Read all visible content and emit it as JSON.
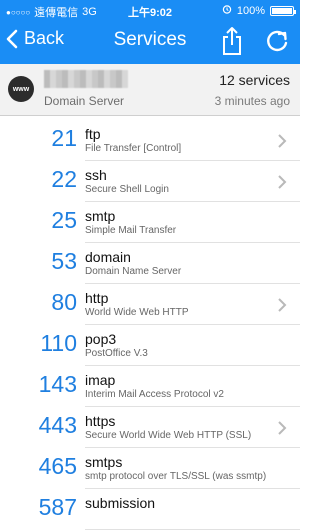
{
  "status_bar": {
    "carrier": "遠傳電信",
    "network": "3G",
    "time": "上午9:02",
    "battery": "100%"
  },
  "nav": {
    "back_label": "Back",
    "title": "Services"
  },
  "server": {
    "hostname_obscured": true,
    "icon_text": "www",
    "type_label": "Domain Server",
    "services_count": "12 services",
    "updated": "3 minutes ago"
  },
  "services": [
    {
      "port": "21",
      "name": "ftp",
      "desc": "File Transfer [Control]",
      "has_chevron": true
    },
    {
      "port": "22",
      "name": "ssh",
      "desc": "Secure Shell Login",
      "has_chevron": true
    },
    {
      "port": "25",
      "name": "smtp",
      "desc": "Simple Mail Transfer",
      "has_chevron": false
    },
    {
      "port": "53",
      "name": "domain",
      "desc": "Domain Name Server",
      "has_chevron": false
    },
    {
      "port": "80",
      "name": "http",
      "desc": "World Wide Web HTTP",
      "has_chevron": true
    },
    {
      "port": "110",
      "name": "pop3",
      "desc": "PostOffice V.3",
      "has_chevron": false
    },
    {
      "port": "143",
      "name": "imap",
      "desc": "Interim Mail Access Protocol v2",
      "has_chevron": false
    },
    {
      "port": "443",
      "name": "https",
      "desc": "Secure World Wide Web HTTP (SSL)",
      "has_chevron": true
    },
    {
      "port": "465",
      "name": "smtps",
      "desc": "smtp protocol over TLS/SSL (was ssmtp)",
      "has_chevron": false
    },
    {
      "port": "587",
      "name": "submission",
      "desc": "",
      "has_chevron": false
    }
  ],
  "colors": {
    "accent": "#1a8df5",
    "port_text": "#1f7fe0"
  },
  "icons": {
    "back": "chevron-left-icon",
    "share": "share-icon",
    "refresh": "refresh-icon",
    "row": "chevron-right-icon"
  }
}
